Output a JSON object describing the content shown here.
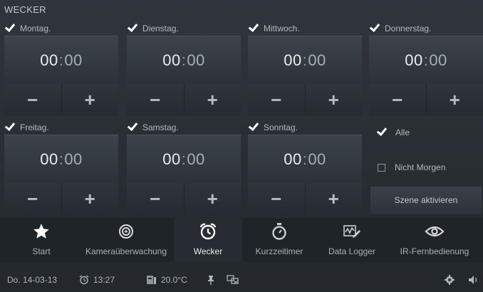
{
  "page": {
    "title": "WECKER"
  },
  "days": [
    {
      "label": "Montag.",
      "checked": true,
      "hours": "00",
      "minutes": "00"
    },
    {
      "label": "Dienstag.",
      "checked": true,
      "hours": "00",
      "minutes": "00"
    },
    {
      "label": "Mittwoch.",
      "checked": true,
      "hours": "00",
      "minutes": "00"
    },
    {
      "label": "Donnerstag.",
      "checked": true,
      "hours": "00",
      "minutes": "00"
    },
    {
      "label": "Freitag.",
      "checked": true,
      "hours": "00",
      "minutes": "00"
    },
    {
      "label": "Samstag.",
      "checked": true,
      "hours": "00",
      "minutes": "00"
    },
    {
      "label": "Sonntag.",
      "checked": true,
      "hours": "00",
      "minutes": "00"
    }
  ],
  "time_separator": ":",
  "adjust": {
    "minus": "−",
    "plus": "+"
  },
  "options": {
    "alle": {
      "label": "Alle",
      "checked": true
    },
    "nicht_morgen": {
      "label": "Nicht Morgen",
      "checked": false
    }
  },
  "scene_button": "Szene aktivieren",
  "nav": [
    {
      "label": "Start",
      "icon": "star-icon",
      "active": false
    },
    {
      "label": "Kameraüberwachung",
      "icon": "camera-icon",
      "active": false
    },
    {
      "label": "Wecker",
      "icon": "alarm-clock-icon",
      "active": true
    },
    {
      "label": "Kurzzeitimer",
      "icon": "stopwatch-icon",
      "active": false
    },
    {
      "label": "Data Logger",
      "icon": "data-logger-icon",
      "active": false
    },
    {
      "label": "IR-Fernbedienung",
      "icon": "eye-icon",
      "active": false
    }
  ],
  "status": {
    "date": "Do. 14-03-13",
    "alarm_time": "13:27",
    "temperature": "20.0°C"
  },
  "colors": {
    "background": "#2a2f35",
    "accent_white": "#ffffff",
    "nav_bar": "#1f2429"
  }
}
